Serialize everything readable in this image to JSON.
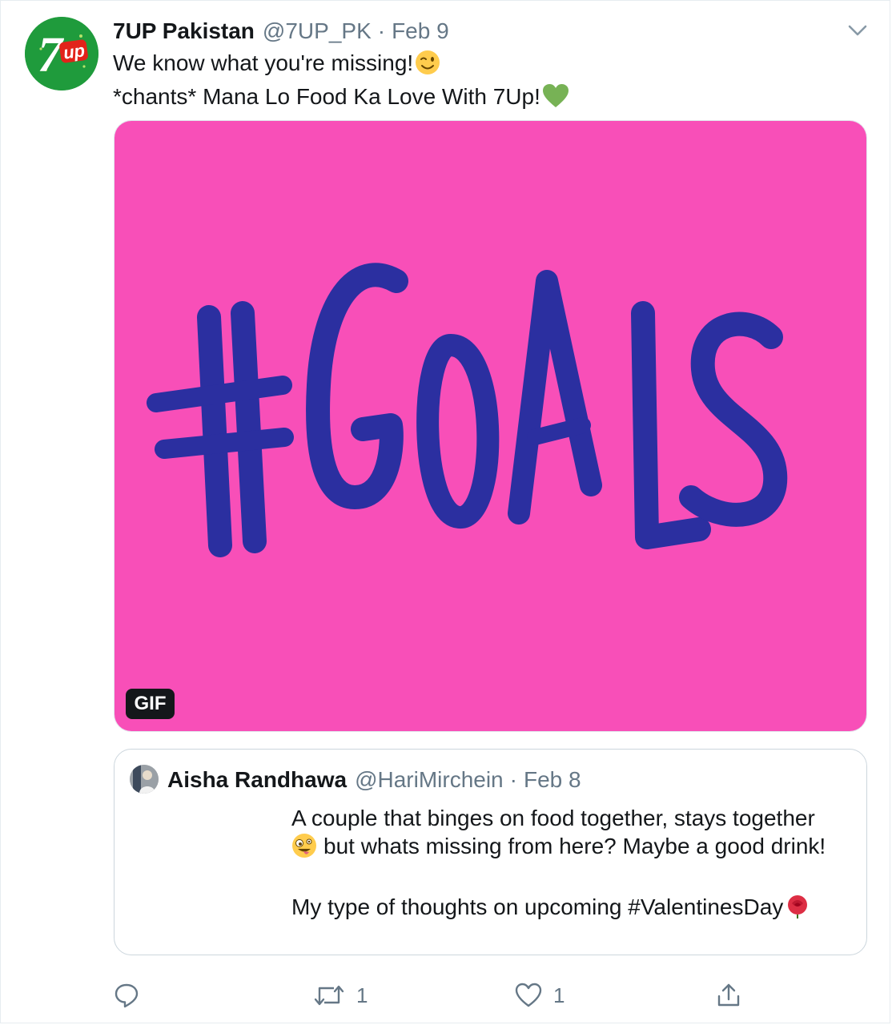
{
  "tweet": {
    "author_name": "7UP Pakistan",
    "author_handle": "@7UP_PK",
    "separator": "·",
    "date": "Feb 9",
    "text_line1": "We know what you're missing!",
    "text_line2": "*chants* Mana Lo Food Ka Love With 7Up!",
    "emoji_1": "winking-face",
    "emoji_2": "green-heart",
    "media_badge": "GIF",
    "media_text": "#GOALS",
    "media_bg_color": "#f84fb8",
    "media_text_color": "#2b2fa0",
    "brand_color": "#1f9b3c",
    "logo_text_7": "7",
    "logo_text_up": "up"
  },
  "quote": {
    "author_name": "Aisha Randhawa",
    "author_handle": "@HariMirchein",
    "separator": "·",
    "date": "Feb 8",
    "para1": "A couple that binges on food together, stays together",
    "para1b": "but whats missing from here? Maybe a good drink!",
    "para2": "My type of thoughts on upcoming #ValentinesDay",
    "emoji_1": "zany-face",
    "emoji_2": "rose"
  },
  "actions": {
    "reply_count": "",
    "retweet_count": "1",
    "like_count": "1"
  }
}
